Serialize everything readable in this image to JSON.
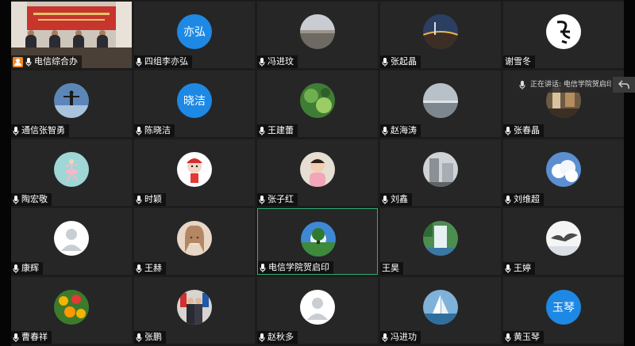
{
  "tooltip": {
    "speaking_text": "正在讲话: 电信学院贺启印"
  },
  "colors": {
    "speaking_border": "#2fae72",
    "host_badge": "#f08a24",
    "text_avatar": "#1e88e5"
  },
  "participants": [
    {
      "name": "电信综合办",
      "avatar": "room-photo",
      "host": true
    },
    {
      "name": "四组李亦弘",
      "avatar": "text",
      "avatar_text": "亦弘"
    },
    {
      "name": "冯进玟",
      "avatar": "lake-photo"
    },
    {
      "name": "张起晶",
      "avatar": "bridge-night-photo"
    },
    {
      "name": "谢雪冬",
      "avatar": "calligraphy-winter",
      "mic": false
    },
    {
      "name": "通信张智勇",
      "avatar": "silhouette-sky-photo"
    },
    {
      "name": "陈晓洁",
      "avatar": "text",
      "avatar_text": "晓洁"
    },
    {
      "name": "王建蕾",
      "avatar": "green-leaves-photo"
    },
    {
      "name": "赵海涛",
      "avatar": "seascape-photo"
    },
    {
      "name": "张春晶",
      "avatar": "interior-photo"
    },
    {
      "name": "陶宏敬",
      "avatar": "ballerina-drawing"
    },
    {
      "name": "时颖",
      "avatar": "cartoon-girl"
    },
    {
      "name": "张子红",
      "avatar": "child-photo"
    },
    {
      "name": "刘鑫",
      "avatar": "building-photo"
    },
    {
      "name": "刘维超",
      "avatar": "clouds-photo"
    },
    {
      "name": "康辉",
      "avatar": "default-person"
    },
    {
      "name": "王赫",
      "avatar": "anime-girl"
    },
    {
      "name": "电信学院贺启印",
      "avatar": "tree-sky-photo",
      "speaking": true
    },
    {
      "name": "王昊",
      "avatar": "waterfall-photo",
      "mic": false
    },
    {
      "name": "王婷",
      "avatar": "bird-flight-photo"
    },
    {
      "name": "曹春祥",
      "avatar": "flowers-photo"
    },
    {
      "name": "张鹏",
      "avatar": "people-flags-photo"
    },
    {
      "name": "赵秋多",
      "avatar": "default-person"
    },
    {
      "name": "冯进功",
      "avatar": "sailboat-photo"
    },
    {
      "name": "黄玉琴",
      "avatar": "text",
      "avatar_text": "玉琴"
    }
  ]
}
